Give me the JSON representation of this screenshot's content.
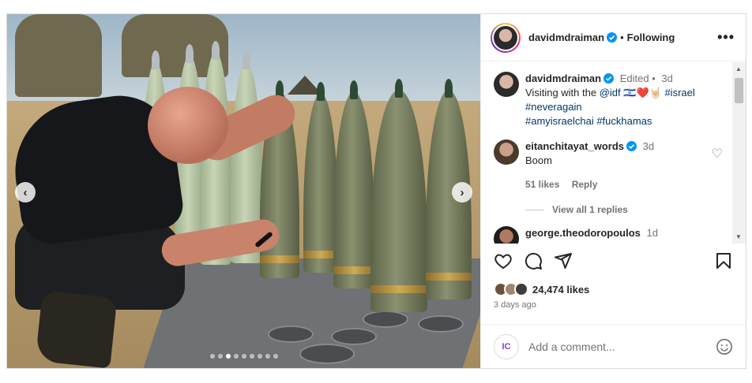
{
  "media": {
    "carousel_total": 9,
    "carousel_active": 3,
    "prev_glyph": "‹",
    "next_glyph": "›"
  },
  "header": {
    "username": "davidmdraiman",
    "separator": "•",
    "follow_status": "Following",
    "more_glyph": "•••"
  },
  "caption": {
    "username": "davidmdraiman",
    "edited": "Edited",
    "separator": "•",
    "time": "3d",
    "text_before": "Visiting with the ",
    "mention": "@idf",
    "flag_emoji": "🇮🇱",
    "emojis": "❤️🤘🏻",
    "tag1": "#israel",
    "tag2": "#neveragain",
    "tag3": "#amyisraelchai",
    "tag4": "#fuckhamas"
  },
  "comments": [
    {
      "username": "eitanchitayat_words",
      "time": "3d",
      "text": "Boom",
      "likes": "51 likes",
      "reply_label": "Reply",
      "view_replies": "View all 1 replies"
    },
    {
      "username": "george.theodoropoulos",
      "time": "1d"
    }
  ],
  "post": {
    "likes": "24,474 likes",
    "date": "3 days ago"
  },
  "composer": {
    "avatar_text": "IC",
    "placeholder": "Add a comment..."
  },
  "icons": {
    "heart": "heart-icon",
    "comment": "comment-icon",
    "share": "share-icon",
    "bookmark": "bookmark-icon",
    "verified": "verified-badge-icon",
    "emoji": "emoji-icon",
    "more": "more-icon"
  },
  "colors": {
    "verified": "#0095f6",
    "link": "#00376b",
    "muted": "#737373"
  }
}
